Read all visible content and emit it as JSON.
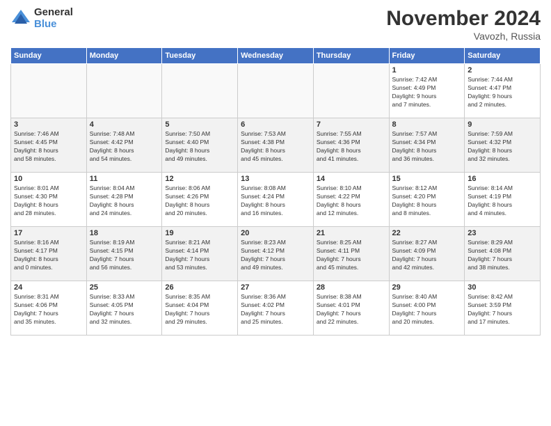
{
  "logo": {
    "general": "General",
    "blue": "Blue"
  },
  "title": "November 2024",
  "location": "Vavozh, Russia",
  "days_of_week": [
    "Sunday",
    "Monday",
    "Tuesday",
    "Wednesday",
    "Thursday",
    "Friday",
    "Saturday"
  ],
  "weeks": [
    [
      {
        "day": "",
        "info": ""
      },
      {
        "day": "",
        "info": ""
      },
      {
        "day": "",
        "info": ""
      },
      {
        "day": "",
        "info": ""
      },
      {
        "day": "",
        "info": ""
      },
      {
        "day": "1",
        "info": "Sunrise: 7:42 AM\nSunset: 4:49 PM\nDaylight: 9 hours\nand 7 minutes."
      },
      {
        "day": "2",
        "info": "Sunrise: 7:44 AM\nSunset: 4:47 PM\nDaylight: 9 hours\nand 2 minutes."
      }
    ],
    [
      {
        "day": "3",
        "info": "Sunrise: 7:46 AM\nSunset: 4:45 PM\nDaylight: 8 hours\nand 58 minutes."
      },
      {
        "day": "4",
        "info": "Sunrise: 7:48 AM\nSunset: 4:42 PM\nDaylight: 8 hours\nand 54 minutes."
      },
      {
        "day": "5",
        "info": "Sunrise: 7:50 AM\nSunset: 4:40 PM\nDaylight: 8 hours\nand 49 minutes."
      },
      {
        "day": "6",
        "info": "Sunrise: 7:53 AM\nSunset: 4:38 PM\nDaylight: 8 hours\nand 45 minutes."
      },
      {
        "day": "7",
        "info": "Sunrise: 7:55 AM\nSunset: 4:36 PM\nDaylight: 8 hours\nand 41 minutes."
      },
      {
        "day": "8",
        "info": "Sunrise: 7:57 AM\nSunset: 4:34 PM\nDaylight: 8 hours\nand 36 minutes."
      },
      {
        "day": "9",
        "info": "Sunrise: 7:59 AM\nSunset: 4:32 PM\nDaylight: 8 hours\nand 32 minutes."
      }
    ],
    [
      {
        "day": "10",
        "info": "Sunrise: 8:01 AM\nSunset: 4:30 PM\nDaylight: 8 hours\nand 28 minutes."
      },
      {
        "day": "11",
        "info": "Sunrise: 8:04 AM\nSunset: 4:28 PM\nDaylight: 8 hours\nand 24 minutes."
      },
      {
        "day": "12",
        "info": "Sunrise: 8:06 AM\nSunset: 4:26 PM\nDaylight: 8 hours\nand 20 minutes."
      },
      {
        "day": "13",
        "info": "Sunrise: 8:08 AM\nSunset: 4:24 PM\nDaylight: 8 hours\nand 16 minutes."
      },
      {
        "day": "14",
        "info": "Sunrise: 8:10 AM\nSunset: 4:22 PM\nDaylight: 8 hours\nand 12 minutes."
      },
      {
        "day": "15",
        "info": "Sunrise: 8:12 AM\nSunset: 4:20 PM\nDaylight: 8 hours\nand 8 minutes."
      },
      {
        "day": "16",
        "info": "Sunrise: 8:14 AM\nSunset: 4:19 PM\nDaylight: 8 hours\nand 4 minutes."
      }
    ],
    [
      {
        "day": "17",
        "info": "Sunrise: 8:16 AM\nSunset: 4:17 PM\nDaylight: 8 hours\nand 0 minutes."
      },
      {
        "day": "18",
        "info": "Sunrise: 8:19 AM\nSunset: 4:15 PM\nDaylight: 7 hours\nand 56 minutes."
      },
      {
        "day": "19",
        "info": "Sunrise: 8:21 AM\nSunset: 4:14 PM\nDaylight: 7 hours\nand 53 minutes."
      },
      {
        "day": "20",
        "info": "Sunrise: 8:23 AM\nSunset: 4:12 PM\nDaylight: 7 hours\nand 49 minutes."
      },
      {
        "day": "21",
        "info": "Sunrise: 8:25 AM\nSunset: 4:11 PM\nDaylight: 7 hours\nand 45 minutes."
      },
      {
        "day": "22",
        "info": "Sunrise: 8:27 AM\nSunset: 4:09 PM\nDaylight: 7 hours\nand 42 minutes."
      },
      {
        "day": "23",
        "info": "Sunrise: 8:29 AM\nSunset: 4:08 PM\nDaylight: 7 hours\nand 38 minutes."
      }
    ],
    [
      {
        "day": "24",
        "info": "Sunrise: 8:31 AM\nSunset: 4:06 PM\nDaylight: 7 hours\nand 35 minutes."
      },
      {
        "day": "25",
        "info": "Sunrise: 8:33 AM\nSunset: 4:05 PM\nDaylight: 7 hours\nand 32 minutes."
      },
      {
        "day": "26",
        "info": "Sunrise: 8:35 AM\nSunset: 4:04 PM\nDaylight: 7 hours\nand 29 minutes."
      },
      {
        "day": "27",
        "info": "Sunrise: 8:36 AM\nSunset: 4:02 PM\nDaylight: 7 hours\nand 25 minutes."
      },
      {
        "day": "28",
        "info": "Sunrise: 8:38 AM\nSunset: 4:01 PM\nDaylight: 7 hours\nand 22 minutes."
      },
      {
        "day": "29",
        "info": "Sunrise: 8:40 AM\nSunset: 4:00 PM\nDaylight: 7 hours\nand 20 minutes."
      },
      {
        "day": "30",
        "info": "Sunrise: 8:42 AM\nSunset: 3:59 PM\nDaylight: 7 hours\nand 17 minutes."
      }
    ]
  ]
}
